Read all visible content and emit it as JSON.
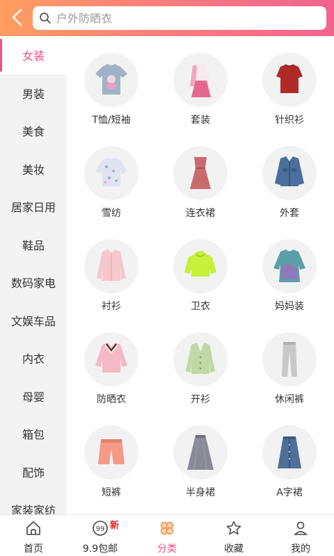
{
  "colors": {
    "accent": "#f04f86",
    "header_start": "#ff9e60",
    "header_end": "#f0638f",
    "badge": "#e02424"
  },
  "header": {
    "back_icon": "chevron-left-icon",
    "search_icon": "search-icon",
    "search_placeholder": "户外防晒衣"
  },
  "sidebar": {
    "items": [
      {
        "label": "女装",
        "active": true
      },
      {
        "label": "男装"
      },
      {
        "label": "美食"
      },
      {
        "label": "美妆"
      },
      {
        "label": "居家日用"
      },
      {
        "label": "鞋品"
      },
      {
        "label": "数码家电"
      },
      {
        "label": "文娱车品"
      },
      {
        "label": "内衣"
      },
      {
        "label": "母婴"
      },
      {
        "label": "箱包"
      },
      {
        "label": "配饰"
      },
      {
        "label": "家装家纺"
      }
    ]
  },
  "categories": [
    {
      "label": "T恤/短袖",
      "icon": "tshirt-icon",
      "color": "#9fb3c8"
    },
    {
      "label": "套装",
      "icon": "outfit-set-icon",
      "color": "#f2a7b9"
    },
    {
      "label": "针织衫",
      "icon": "knit-sweater-icon",
      "color": "#b02a28"
    },
    {
      "label": "雪纺",
      "icon": "chiffon-blouse-icon",
      "color": "#c9cde6"
    },
    {
      "label": "连衣裙",
      "icon": "dress-icon",
      "color": "#c86a6e"
    },
    {
      "label": "外套",
      "icon": "denim-jacket-icon",
      "color": "#4a6f9c"
    },
    {
      "label": "衬衫",
      "icon": "shirt-icon",
      "color": "#f6c7cf"
    },
    {
      "label": "卫衣",
      "icon": "hoodie-icon",
      "color": "#c6f03a"
    },
    {
      "label": "妈妈装",
      "icon": "mom-top-icon",
      "color": "#5aa0a6"
    },
    {
      "label": "防晒衣",
      "icon": "sun-protection-jacket-icon",
      "color": "#f5b8c6"
    },
    {
      "label": "开衫",
      "icon": "cardigan-icon",
      "color": "#bfd8a6"
    },
    {
      "label": "休闲裤",
      "icon": "casual-pants-icon",
      "color": "#c8c8c8"
    },
    {
      "label": "短裤",
      "icon": "shorts-icon",
      "color": "#f39a86"
    },
    {
      "label": "半身裙",
      "icon": "skirt-icon",
      "color": "#8a8a96"
    },
    {
      "label": "A字裙",
      "icon": "a-line-skirt-icon",
      "color": "#4e6f98"
    }
  ],
  "tabbar": {
    "items": [
      {
        "label": "首页",
        "icon": "home-icon"
      },
      {
        "label": "9.9包邮",
        "icon": "ninety-nine-icon",
        "badge": "新"
      },
      {
        "label": "分类",
        "icon": "category-clover-icon",
        "active": true
      },
      {
        "label": "收藏",
        "icon": "star-icon"
      },
      {
        "label": "我的",
        "icon": "user-icon"
      }
    ]
  }
}
